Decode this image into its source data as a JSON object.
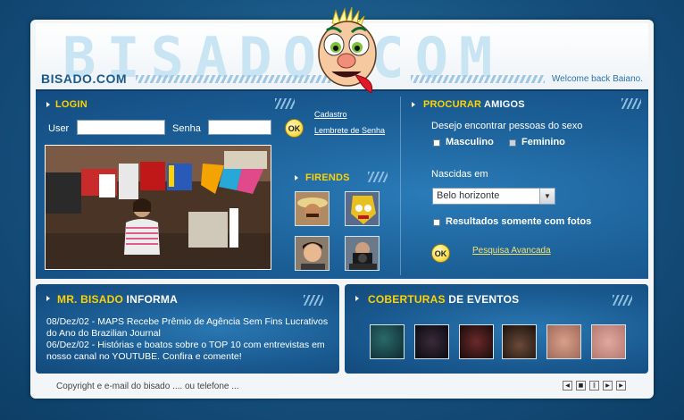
{
  "header": {
    "bg_word": "BISADO.COM",
    "logo": "BISADO.COM",
    "welcome": "Welcome back Baiano."
  },
  "login": {
    "title": "LOGIN",
    "user_label": "User",
    "user_value": "",
    "pass_label": "Senha",
    "pass_value": "",
    "ok": "OK",
    "cadastro": "Cadastro",
    "lembrete": "Lembrete de Senha"
  },
  "friends": {
    "title": "FIRENDS"
  },
  "search": {
    "title_accent": "PROCURAR",
    "title_rest": "AMIGOS",
    "desire": "Desejo encontrar pessoas do sexo",
    "masculino": "Masculino",
    "feminino": "Feminino",
    "born_label": "Nascidas em",
    "city": "Belo horizonte",
    "photos_only": "Resultados somente com fotos",
    "ok": "OK",
    "advanced": "Pesquisa Avancada"
  },
  "informa": {
    "title_accent": "MR. BISADO",
    "title_rest": "INFORMA",
    "items": [
      "08/Dez/02 - MAPS Recebe Prêmio de Agência Sem Fins Lucrativos do Ano do Brazilian Journal",
      "06/Dez/02 - Histórias e boatos sobre o TOP 10 com entrevistas em nosso canal no YOUTUBE. Confira e comente!"
    ]
  },
  "eventos": {
    "title_accent": "COBERTURAS",
    "title_rest": "DE EVENTOS"
  },
  "footer": {
    "text": "Copyright e e-mail do bisado .... ou telefone ..."
  },
  "icons": {
    "prev": "skip-back-icon",
    "stop": "stop-icon",
    "pause": "pause-icon",
    "play": "play-icon",
    "next": "skip-forward-icon"
  },
  "colors": {
    "accent_yellow": "#ffd200",
    "panel_blue": "#1b5e96",
    "logo_blue": "#1a5a8c"
  }
}
